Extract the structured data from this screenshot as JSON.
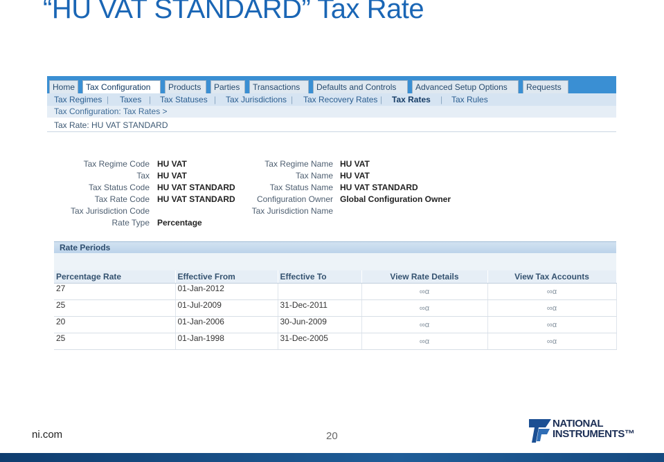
{
  "slide": {
    "title": "“HU VAT STANDARD” Tax Rate",
    "footer_left": "ni.com",
    "page_number": "20",
    "logo": {
      "line1": "NATIONAL",
      "line2": "INSTRUMENTS™"
    }
  },
  "tabs": [
    {
      "label": "Home",
      "active": false
    },
    {
      "label": "Tax Configuration",
      "active": true
    },
    {
      "label": "Products",
      "active": false
    },
    {
      "label": "Parties",
      "active": false
    },
    {
      "label": "Transactions",
      "active": false
    },
    {
      "label": "Defaults and Controls",
      "active": false
    },
    {
      "label": "Advanced Setup Options",
      "active": false
    },
    {
      "label": "Requests",
      "active": false
    }
  ],
  "subnav": [
    {
      "label": "Tax Regimes",
      "selected": false
    },
    {
      "label": "Taxes",
      "selected": false
    },
    {
      "label": "Tax Statuses",
      "selected": false
    },
    {
      "label": "Tax Jurisdictions",
      "selected": false
    },
    {
      "label": "Tax Recovery Rates",
      "selected": false
    },
    {
      "label": "Tax Rates",
      "selected": true
    },
    {
      "label": "Tax Rules",
      "selected": false
    }
  ],
  "breadcrumb": "Tax Configuration: Tax Rates  >",
  "page_header": "Tax Rate: HU VAT STANDARD",
  "fields_left": [
    {
      "label": "Tax Regime Code",
      "value": "HU VAT"
    },
    {
      "label": "Tax",
      "value": "HU VAT"
    },
    {
      "label": "Tax Status Code",
      "value": "HU VAT STANDARD"
    },
    {
      "label": "Tax Rate Code",
      "value": "HU VAT STANDARD"
    },
    {
      "label": "Tax Jurisdiction Code",
      "value": ""
    },
    {
      "label": "Rate Type",
      "value": "Percentage"
    }
  ],
  "fields_right": [
    {
      "label": "Tax Regime Name",
      "value": "HU VAT"
    },
    {
      "label": "Tax Name",
      "value": "HU VAT"
    },
    {
      "label": "Tax Status Name",
      "value": "HU VAT STANDARD"
    },
    {
      "label": "Configuration Owner",
      "value": "Global Configuration Owner"
    },
    {
      "label": "Tax Jurisdiction Name",
      "value": ""
    }
  ],
  "rate_periods": {
    "title": "Rate Periods",
    "columns": [
      "Percentage Rate",
      "Effective From",
      "Effective To",
      "View Rate Details",
      "View Tax Accounts"
    ],
    "rows": [
      {
        "rate": "27",
        "from": "01-Jan-2012",
        "to": ""
      },
      {
        "rate": "25",
        "from": "01-Jul-2009",
        "to": "31-Dec-2011"
      },
      {
        "rate": "20",
        "from": "01-Jan-2006",
        "to": "30-Jun-2009"
      },
      {
        "rate": "25",
        "from": "01-Jan-1998",
        "to": "31-Dec-2005"
      }
    ],
    "view_glyph": "∞α"
  },
  "colors": {
    "title_blue": "#1a66b5",
    "tab_band": "#3a8fd3",
    "footer_bar": "#164a80"
  }
}
